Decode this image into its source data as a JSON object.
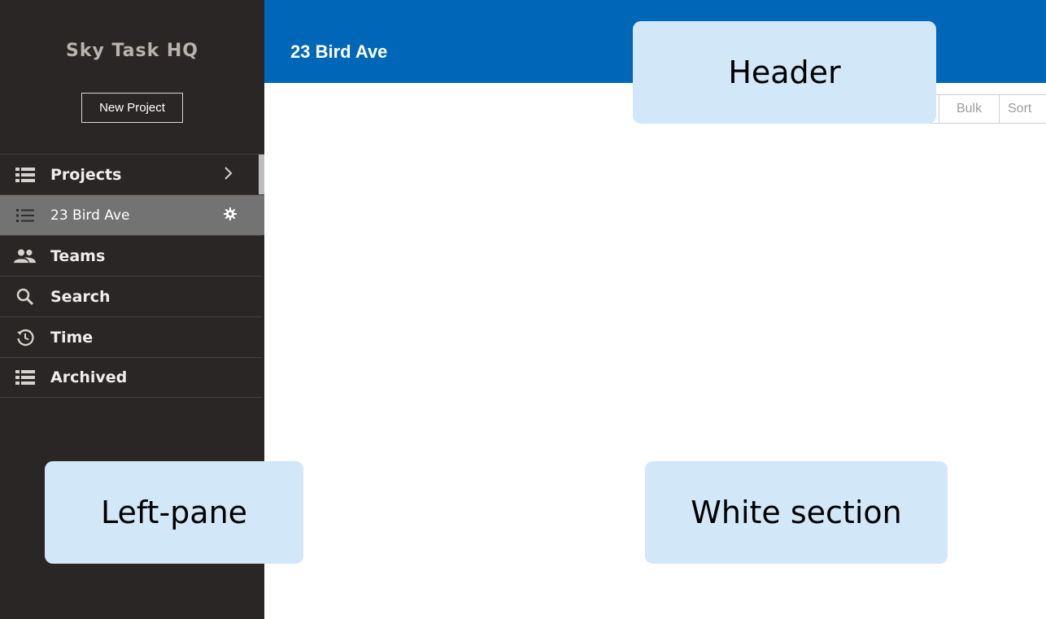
{
  "sidebar": {
    "brand": "Sky Task HQ",
    "new_project_label": "New Project",
    "items": [
      {
        "label": "Projects",
        "icon": "list-grid-icon"
      },
      {
        "label": "23 Bird Ave",
        "icon": "list-icon"
      },
      {
        "label": "Teams",
        "icon": "people-icon"
      },
      {
        "label": "Search",
        "icon": "search-icon"
      },
      {
        "label": "Time",
        "icon": "history-icon"
      },
      {
        "label": "Archived",
        "icon": "list-grid-icon"
      }
    ]
  },
  "header": {
    "title": "23 Bird Ave"
  },
  "toolbar": {
    "bulk_label": "Bulk",
    "sort_label": "Sort"
  },
  "callouts": {
    "header": "Header",
    "left_pane": "Left-pane",
    "white_section": "White section"
  },
  "colors": {
    "sidebar_bg": "#292625",
    "header_bg": "#0067b8",
    "active_item_bg": "#737373",
    "callout_bg": "#d2e7f8"
  }
}
